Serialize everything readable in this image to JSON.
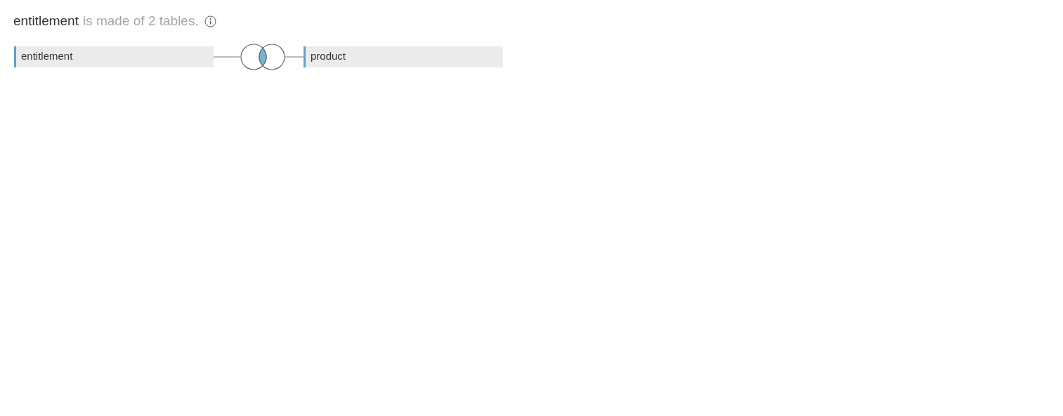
{
  "heading": {
    "source_name": "entitlement",
    "description": "is made of 2 tables."
  },
  "tables": [
    {
      "name": "entitlement"
    },
    {
      "name": "product"
    }
  ],
  "join": {
    "kind": "inner"
  }
}
